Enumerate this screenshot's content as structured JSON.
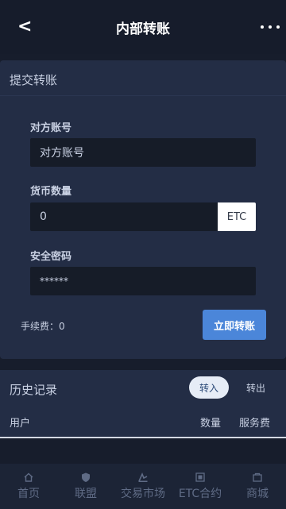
{
  "header": {
    "back_glyph": "<",
    "title": "内部转账",
    "more_icon": "more-icon"
  },
  "form": {
    "section_title": "提交转账",
    "account": {
      "label": "对方账号",
      "placeholder": "对方账号"
    },
    "amount": {
      "label": "货币数量",
      "value": "0",
      "unit": "ETC"
    },
    "password": {
      "label": "安全密码",
      "value": "******"
    },
    "fee_label": "手续费：",
    "fee_value": "0",
    "submit_label": "立即转账"
  },
  "history": {
    "title": "历史记录",
    "tabs": [
      "转入",
      "转出"
    ],
    "active_tab": "转入",
    "columns": [
      "用户",
      "数量",
      "服务费"
    ]
  },
  "tabbar": {
    "items": [
      {
        "label": "首页",
        "icon": "home-icon"
      },
      {
        "label": "联盟",
        "icon": "shield-icon"
      },
      {
        "label": "交易市场",
        "icon": "market-icon"
      },
      {
        "label": "ETC合约",
        "icon": "contract-icon"
      },
      {
        "label": "商城",
        "icon": "shop-icon"
      }
    ]
  },
  "colors": {
    "background": "#171d2c",
    "card": "#232d45",
    "accent": "#4b86d9"
  }
}
